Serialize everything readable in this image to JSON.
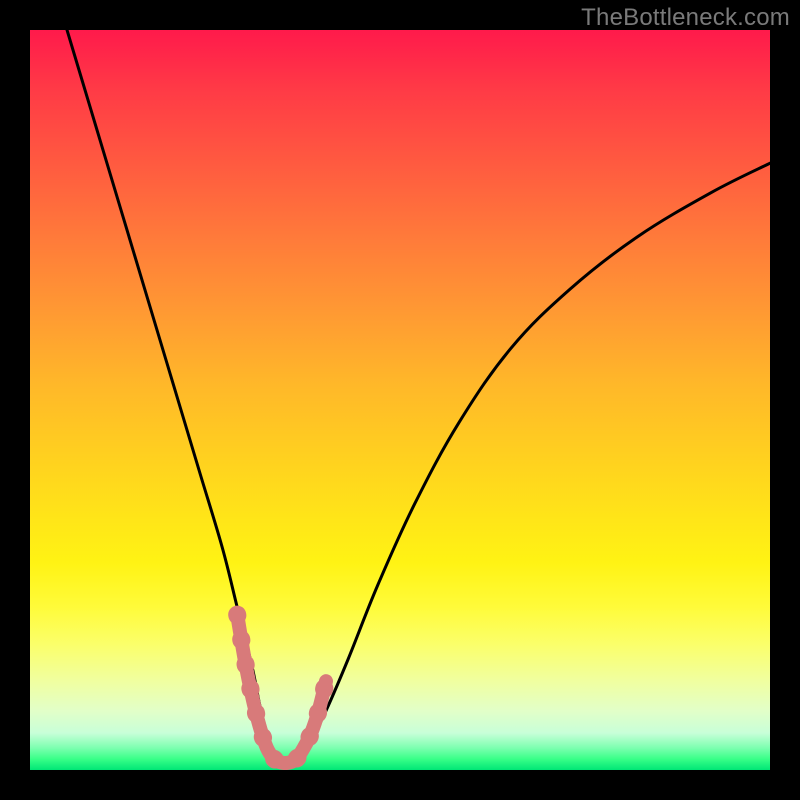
{
  "watermark": "TheBottleneck.com",
  "chart_data": {
    "type": "line",
    "title": "",
    "xlabel": "",
    "ylabel": "",
    "xlim": [
      0,
      100
    ],
    "ylim": [
      0,
      100
    ],
    "series": [
      {
        "name": "bottleneck-curve",
        "x": [
          5,
          8,
          11,
          14,
          17,
          20,
          23,
          26,
          28,
          30,
          31,
          32,
          33,
          34,
          35,
          36,
          37,
          38,
          40,
          43,
          47,
          52,
          58,
          65,
          73,
          82,
          92,
          100
        ],
        "y": [
          100,
          90,
          80,
          70,
          60,
          50,
          40,
          30,
          22,
          14,
          9,
          5,
          2,
          1,
          1,
          1,
          2,
          4,
          8,
          15,
          25,
          36,
          47,
          57,
          65,
          72,
          78,
          82
        ]
      },
      {
        "name": "optimal-zone",
        "x": [
          28,
          29,
          30,
          31,
          32,
          33,
          34,
          35,
          36,
          37,
          38,
          39,
          40
        ],
        "y": [
          21,
          15,
          10,
          6,
          3,
          1.5,
          1,
          1,
          1.5,
          3,
          5,
          8,
          12
        ]
      }
    ],
    "gradient_stops": [
      {
        "pos": 0,
        "color": "#ff1a4b"
      },
      {
        "pos": 0.5,
        "color": "#ffd11f"
      },
      {
        "pos": 0.78,
        "color": "#fffb3a"
      },
      {
        "pos": 1.0,
        "color": "#00e676"
      }
    ]
  }
}
